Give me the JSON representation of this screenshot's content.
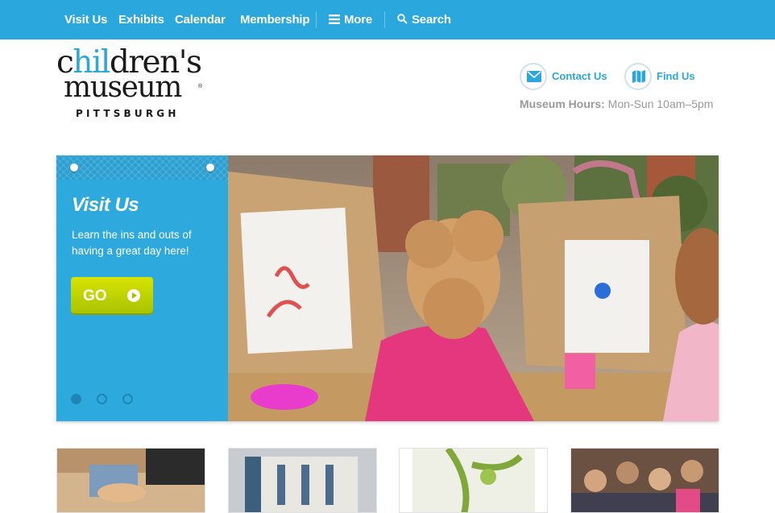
{
  "nav": {
    "items": [
      "Visit Us",
      "Exhibits",
      "Calendar",
      "Membership"
    ],
    "more_label": "More",
    "search_label": "Search",
    "bg_color": "#2aa7dc"
  },
  "logo": {
    "line1_a": "c",
    "line1_hi": "hil",
    "line1_b": "dren's",
    "line2": "museum",
    "line3": "PITTSBURGH",
    "reg": "®"
  },
  "header": {
    "contact_label": "Contact Us",
    "find_label": "Find Us",
    "hours_label": "Museum Hours:",
    "hours_value": " Mon-Sun 10am–5pm"
  },
  "hero": {
    "title": "Visit Us",
    "description": "Learn the ins and outs of having a great day here!",
    "button_label": "GO",
    "slide_count": 3,
    "active_slide": 1
  },
  "thumbnails": [
    "art-activity-photo",
    "exhibit-photo",
    "illustration-photo",
    "crowd-photo"
  ]
}
